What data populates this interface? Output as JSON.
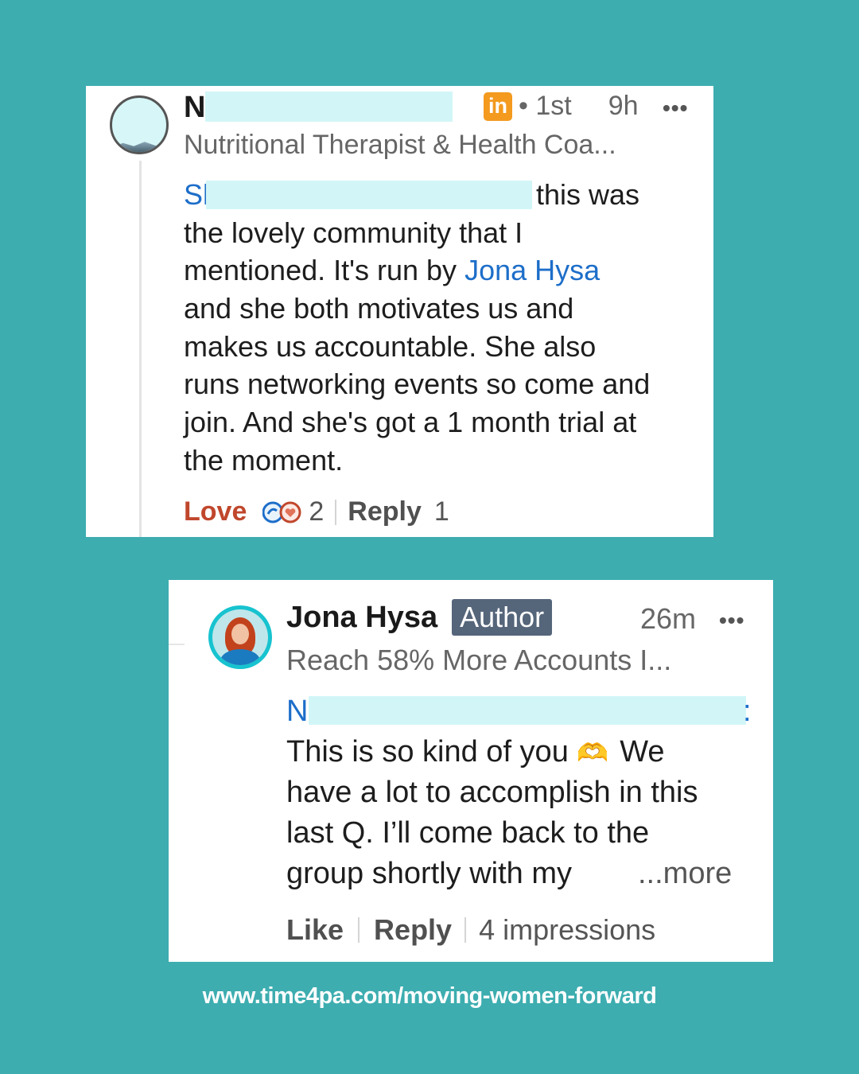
{
  "comment": {
    "name_initial": "N",
    "degree": "• 1st",
    "time": "9h",
    "menu": "•••",
    "headline": "Nutritional Therapist & Health Coa...",
    "mention_initial": "Sl",
    "body_lines": [
      "this was",
      "the lovely community that I",
      "mentioned. It's run by ",
      "and she both motivates us and",
      "makes us accountable. She also",
      "runs networking events so come and",
      "join. And she's got a 1 month trial at",
      "the moment."
    ],
    "mention_jona": "Jona Hysa",
    "actions": {
      "love": "Love",
      "reaction_count": "2",
      "reply": "Reply",
      "reply_count": "1"
    }
  },
  "reply": {
    "name": "Jona Hysa",
    "badge": "Author",
    "time": "26m",
    "menu": "•••",
    "headline": "Reach 58% More Accounts I...",
    "mention_initial": "N",
    "mention_tail": ":",
    "body_lines": [
      "This is so kind of you ",
      "have a lot to accomplish in this",
      "last Q. I’ll come back to the",
      "group shortly with my"
    ],
    "line1_tail": "We",
    "emoji": "🫶",
    "more": "...more",
    "actions": {
      "like": "Like",
      "reply": "Reply",
      "impressions": "4 impressions"
    }
  },
  "footer": {
    "url": "www.time4pa.com/moving-women-forward"
  }
}
